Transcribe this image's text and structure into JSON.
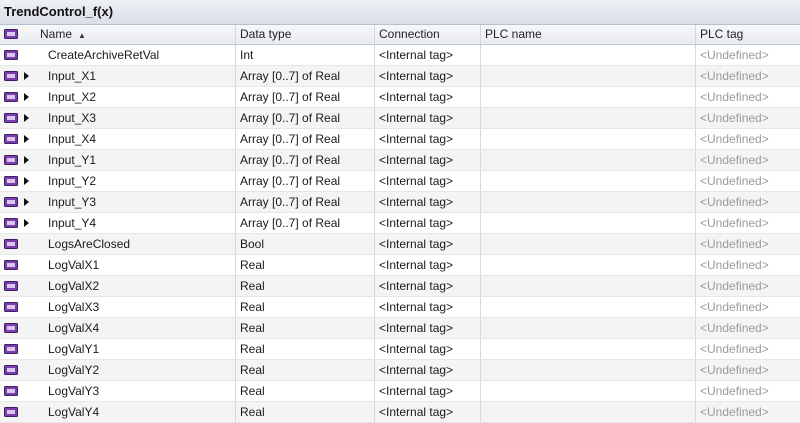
{
  "window": {
    "title": "TrendControl_f(x)"
  },
  "columns": {
    "name": "Name",
    "data_type": "Data type",
    "connection": "Connection",
    "plc_name": "PLC name",
    "plc_tag": "PLC tag"
  },
  "colors": {
    "tag_icon_fill": "#7b3fa8",
    "tag_icon_border": "#3d1a66",
    "undefined_text": "#9a9a9a"
  },
  "rows": [
    {
      "name": "CreateArchiveRetVal",
      "data_type": "Int",
      "connection": "<Internal tag>",
      "plc_name": "",
      "plc_tag": "<Undefined>",
      "expandable": false
    },
    {
      "name": "Input_X1",
      "data_type": "Array [0..7] of Real",
      "connection": "<Internal tag>",
      "plc_name": "",
      "plc_tag": "<Undefined>",
      "expandable": true
    },
    {
      "name": "Input_X2",
      "data_type": "Array [0..7] of Real",
      "connection": "<Internal tag>",
      "plc_name": "",
      "plc_tag": "<Undefined>",
      "expandable": true
    },
    {
      "name": "Input_X3",
      "data_type": "Array [0..7] of Real",
      "connection": "<Internal tag>",
      "plc_name": "",
      "plc_tag": "<Undefined>",
      "expandable": true
    },
    {
      "name": "Input_X4",
      "data_type": "Array [0..7] of Real",
      "connection": "<Internal tag>",
      "plc_name": "",
      "plc_tag": "<Undefined>",
      "expandable": true
    },
    {
      "name": "Input_Y1",
      "data_type": "Array [0..7] of Real",
      "connection": "<Internal tag>",
      "plc_name": "",
      "plc_tag": "<Undefined>",
      "expandable": true
    },
    {
      "name": "Input_Y2",
      "data_type": "Array [0..7] of Real",
      "connection": "<Internal tag>",
      "plc_name": "",
      "plc_tag": "<Undefined>",
      "expandable": true
    },
    {
      "name": "Input_Y3",
      "data_type": "Array [0..7] of Real",
      "connection": "<Internal tag>",
      "plc_name": "",
      "plc_tag": "<Undefined>",
      "expandable": true
    },
    {
      "name": "Input_Y4",
      "data_type": "Array [0..7] of Real",
      "connection": "<Internal tag>",
      "plc_name": "",
      "plc_tag": "<Undefined>",
      "expandable": true
    },
    {
      "name": "LogsAreClosed",
      "data_type": "Bool",
      "connection": "<Internal tag>",
      "plc_name": "",
      "plc_tag": "<Undefined>",
      "expandable": false
    },
    {
      "name": "LogValX1",
      "data_type": "Real",
      "connection": "<Internal tag>",
      "plc_name": "",
      "plc_tag": "<Undefined>",
      "expandable": false
    },
    {
      "name": "LogValX2",
      "data_type": "Real",
      "connection": "<Internal tag>",
      "plc_name": "",
      "plc_tag": "<Undefined>",
      "expandable": false
    },
    {
      "name": "LogValX3",
      "data_type": "Real",
      "connection": "<Internal tag>",
      "plc_name": "",
      "plc_tag": "<Undefined>",
      "expandable": false
    },
    {
      "name": "LogValX4",
      "data_type": "Real",
      "connection": "<Internal tag>",
      "plc_name": "",
      "plc_tag": "<Undefined>",
      "expandable": false
    },
    {
      "name": "LogValY1",
      "data_type": "Real",
      "connection": "<Internal tag>",
      "plc_name": "",
      "plc_tag": "<Undefined>",
      "expandable": false
    },
    {
      "name": "LogValY2",
      "data_type": "Real",
      "connection": "<Internal tag>",
      "plc_name": "",
      "plc_tag": "<Undefined>",
      "expandable": false
    },
    {
      "name": "LogValY3",
      "data_type": "Real",
      "connection": "<Internal tag>",
      "plc_name": "",
      "plc_tag": "<Undefined>",
      "expandable": false
    },
    {
      "name": "LogValY4",
      "data_type": "Real",
      "connection": "<Internal tag>",
      "plc_name": "",
      "plc_tag": "<Undefined>",
      "expandable": false
    }
  ]
}
